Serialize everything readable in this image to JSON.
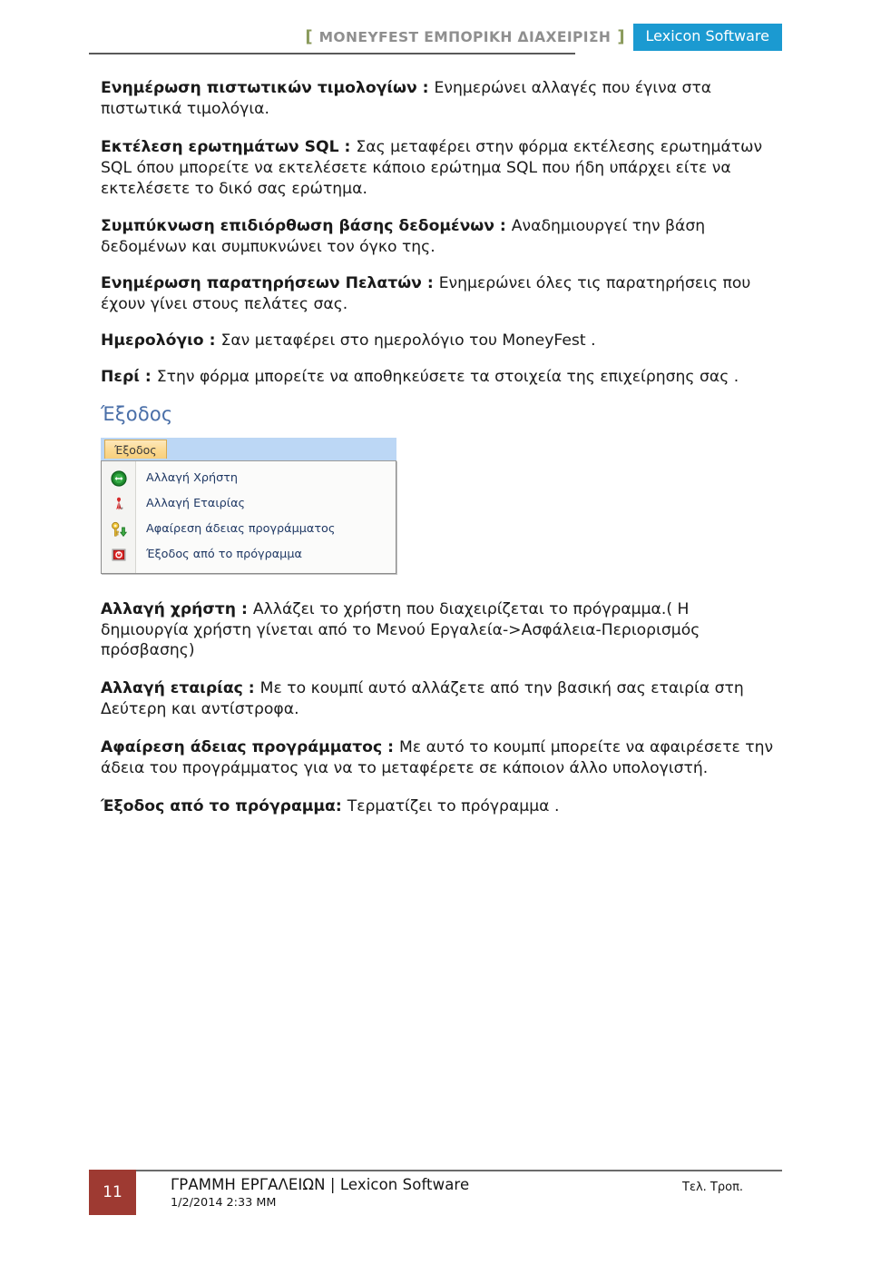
{
  "header": {
    "bracket_open": "[",
    "bracket_close": "]",
    "title": "MONEYFEST ΕΜΠΟΡΙΚΗ ΔΙΑΧΕΙΡΙΣΗ",
    "brand": "Lexicon Software",
    "brand_bg_color": "#1b9ad1",
    "bracket_color": "#8a9a5b",
    "title_color": "#8f8f8f"
  },
  "body": {
    "paragraphs": [
      {
        "lead": "Ενημέρωση πιστωτικών τιμολογίων : ",
        "text": "Ενημερώνει αλλαγές που έγινα στα πιστωτικά τιμολόγια."
      },
      {
        "lead": "Εκτέλεση ερωτημάτων SQL : ",
        "text": "Σας μεταφέρει στην φόρμα εκτέλεσης ερωτημάτων SQL όπου μπορείτε να εκτελέσετε κάποιο ερώτημα SQL που ήδη υπάρχει είτε να εκτελέσετε το δικό σας ερώτημα."
      },
      {
        "lead": "Συμπύκνωση επιδιόρθωση βάσης δεδομένων : ",
        "text": "Αναδημιουργεί την βάση δεδομένων και συμπυκνώνει τον όγκο της."
      },
      {
        "lead": "Ενημέρωση παρατηρήσεων Πελατών : ",
        "text": "Ενημερώνει όλες τις παρατηρήσεις που έχουν γίνει στους πελάτες σας."
      },
      {
        "lead": "Ημερολόγιο : ",
        "text": "Σαν μεταφέρει στο ημερολόγιο του MoneyFest ."
      },
      {
        "lead": "Περί : ",
        "text": "Στην φόρμα μπορείτε να αποθηκεύσετε τα στοιχεία της επιχείρησης σας ."
      }
    ],
    "section_heading": "Έξοδος",
    "section_heading_color": "#4a6fa8",
    "paragraphs_after": [
      {
        "lead": "Αλλαγή χρήστη : ",
        "text": "Αλλάζει το χρήστη που διαχειρίζεται το πρόγραμμα.( Η δημιουργία χρήστη γίνεται από το Μενού Εργαλεία->Ασφάλεια-Περιορισμός πρόσβασης)"
      },
      {
        "lead": "Αλλαγή εταιρίας : ",
        "text": "Με το κουμπί αυτό αλλάζετε από την βασική σας εταιρία στη Δεύτερη και αντίστροφα."
      },
      {
        "lead": "Αφαίρεση άδειας προγράμματος : ",
        "text": "Με αυτό το κουμπί μπορείτε να αφαιρέσετε την άδεια του προγράμματος για να το μεταφέρετε σε κάποιον άλλο υπολογιστή."
      },
      {
        "lead": "Έξοδος από το πρόγραμμα:  ",
        "text": "Τερματίζει το πρόγραμμα ."
      }
    ]
  },
  "screenshot": {
    "tab_label": "Έξοδος",
    "menu_items": [
      {
        "icon": "change-user-icon",
        "label": "Αλλαγή Χρήστη"
      },
      {
        "icon": "change-company-icon",
        "label": "Αλλαγή Εταιρίας"
      },
      {
        "icon": "remove-license-key-icon",
        "label": "Αφαίρεση άδειας προγράμματος"
      },
      {
        "icon": "exit-program-icon",
        "label": "Έξοδος από το πρόγραμμα"
      }
    ]
  },
  "footer": {
    "page_number": "11",
    "title": "ΓΡΑΜΜΗ ΕΡΓΑΛΕΙΩΝ | Lexicon Software",
    "date": "1/2/2014 2:33 ΜΜ",
    "right_label": "Τελ. Τροπ.",
    "page_box_color": "#9e3a32"
  }
}
